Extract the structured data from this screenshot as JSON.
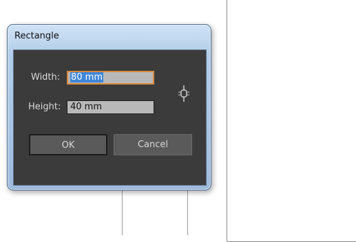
{
  "dialog": {
    "title": "Rectangle",
    "width_label": "Width:",
    "width_value": "80 mm",
    "height_label": "Height:",
    "height_value": "40 mm",
    "constrain_icon": "chain-link-icon",
    "ok_label": "OK",
    "cancel_label": "Cancel"
  },
  "colors": {
    "panel_background": "#3b3b3b",
    "focus_border": "#d98a3c",
    "selection": "#3f86d9",
    "title_bar": "#b3cde8"
  }
}
